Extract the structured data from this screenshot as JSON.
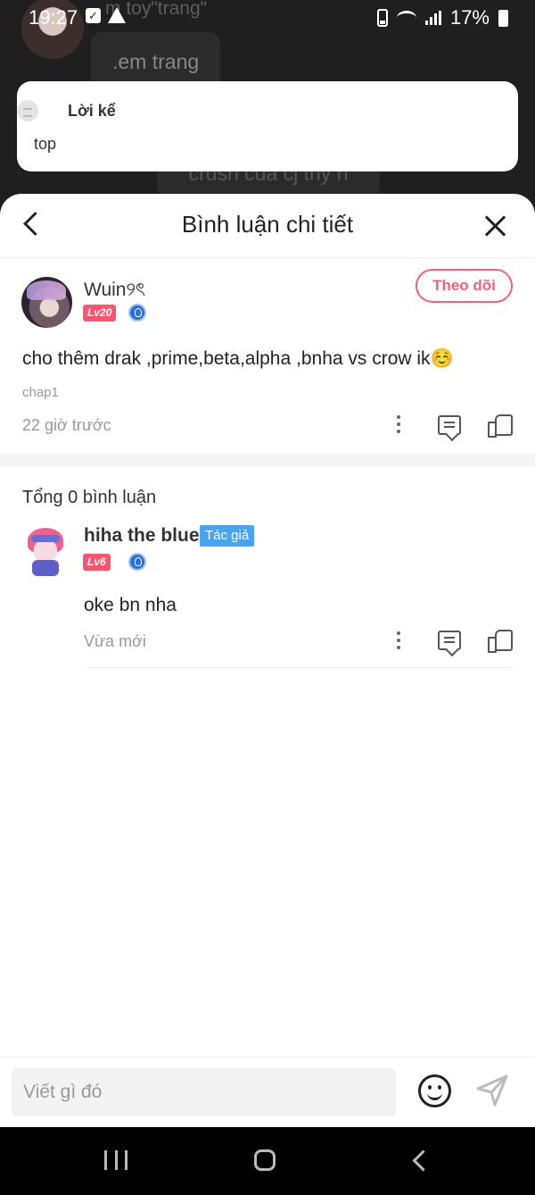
{
  "status_bar": {
    "time": "19:27",
    "battery": "17%"
  },
  "background_chat": {
    "top_text": "m toy\"trang\"",
    "bubble_text": ".em trang",
    "bubble2_text": "crush của cj thy h"
  },
  "narration": {
    "title": "Lời kể",
    "text": "top"
  },
  "header": {
    "title": "Bình luận chi tiết"
  },
  "main_comment": {
    "username": "Wuin୨ৎ",
    "level": "Lv20",
    "follow_label": "Theo dõi",
    "text": "cho thêm drak ,prime,beta,alpha ,bnha vs crow ik☺️",
    "chapter": "chap1",
    "time": "22 giờ trước"
  },
  "replies_section": {
    "total_label": "Tổng 0 bình luận",
    "replies": [
      {
        "username": "hiha the blue",
        "author_tag": "Tác giả",
        "level": "Lv6",
        "text": "oke bn nha",
        "time": "Vừa mới"
      }
    ]
  },
  "input": {
    "placeholder": "Viết gì đó"
  },
  "colors": {
    "accent": "#f0617a",
    "level_badge": "#ff5470",
    "author_tag": "#49a4f0"
  }
}
